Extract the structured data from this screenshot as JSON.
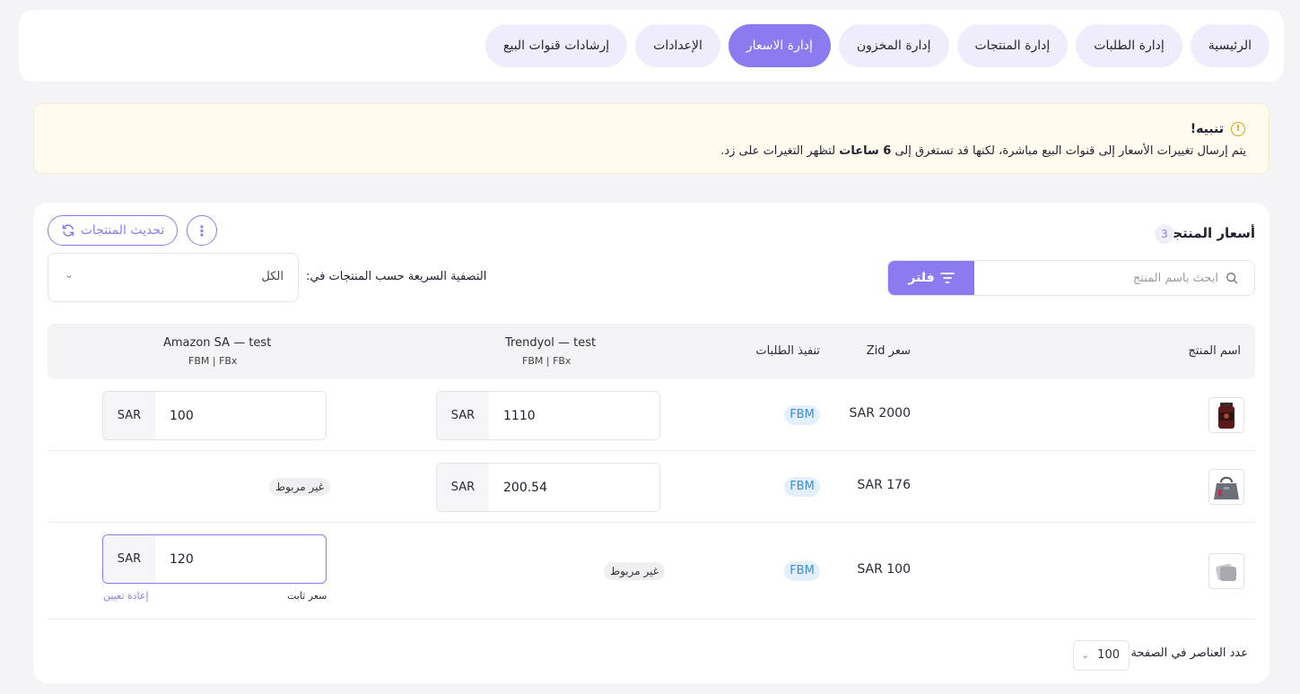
{
  "nav": {
    "tabs": [
      {
        "label": "الرئيسية",
        "active": false
      },
      {
        "label": "إدارة الطلبات",
        "active": false
      },
      {
        "label": "إدارة المنتجات",
        "active": false
      },
      {
        "label": "إدارة المخزون",
        "active": false
      },
      {
        "label": "إدارة الاسعار",
        "active": true
      },
      {
        "label": "الإعدادات",
        "active": false
      },
      {
        "label": "إرشادات قنوات البيع",
        "active": false
      }
    ]
  },
  "alert": {
    "title": "تنبيه!",
    "text_before": "يتم إرسال تغييرات الأسعار إلى قنوات البيع مباشرة، لكنها قد تستغرق إلى ",
    "text_bold": "6 ساعات",
    "text_after": " لتظهر التغيرات على زد.",
    "icon": "warning-circle-icon",
    "icon_glyph": "!"
  },
  "products": {
    "title": "أسعار المنتجات",
    "count": "3",
    "refresh_label": "تحديث المنتجات",
    "more_glyph": "⋮",
    "search_placeholder": "ابحث باسم المنتج",
    "filter_label": "فلتر",
    "quick_filter_label": "التصفية السريعة حسب المنتجات في:",
    "quick_filter_value": "الكل",
    "chevron_glyph": "⌄"
  },
  "table": {
    "headers": {
      "name": "اسم المنتج",
      "zid_price": "سعر Zid",
      "fulfillment": "تنفيذ الطلبات",
      "trendyol": "Trendyol — test",
      "trendyol_sub": "FBM | FBx",
      "amazon": "Amazon SA — test",
      "amazon_sub": "FBM | FBx"
    },
    "currency": "SAR",
    "unlinked_label": "غير مربوط",
    "fixed_price_label": "سعر ثابت",
    "reset_label": "إعادة تعيين",
    "rows": [
      {
        "zid_price": "SAR 2000",
        "fulfillment": "FBM",
        "trendyol_price": "1110",
        "amazon_price": "100"
      },
      {
        "zid_price": "SAR 176",
        "fulfillment": "FBM",
        "trendyol_price": "200.54",
        "amazon_price": ""
      },
      {
        "zid_price": "SAR 100",
        "fulfillment": "FBM",
        "trendyol_price": "",
        "amazon_price": "120"
      }
    ]
  },
  "pagination": {
    "per_page_label": "عدد العناصر في الصفحة",
    "per_page_value": "100"
  },
  "colors": {
    "accent": "#8a7cf0",
    "fbm_badge_bg": "#e3f0fc",
    "fbm_badge_text": "#3b8bdc",
    "alert_bg": "#fffbee",
    "warning_icon": "#d2a617"
  }
}
